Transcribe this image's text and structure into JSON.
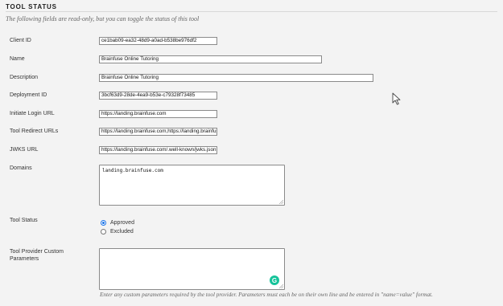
{
  "section": {
    "title": "TOOL STATUS",
    "note": "The following fields are read-only, but you can toggle the status of this tool"
  },
  "fields": {
    "client_id": {
      "label": "Client ID",
      "value": "ce1bab09-ea32-48d9-a0ad-b538be976df2"
    },
    "name": {
      "label": "Name",
      "value": "Brainfuse Online Tutoring"
    },
    "description": {
      "label": "Description",
      "value": "Brainfuse Online Tutoring"
    },
    "deployment_id": {
      "label": "Deployment ID",
      "value": "3bcf63d9-28de-4ea9-b53e-c79328f73485"
    },
    "initiate_login_url": {
      "label": "Initiate Login URL",
      "value": "https://landing.brainfuse.com"
    },
    "tool_redirect_urls": {
      "label": "Tool Redirect URLs",
      "value": "https://landing.brainfuse.com,https://landing.brainfuse.com/"
    },
    "jwks_url": {
      "label": "JWKS URL",
      "value": "https://landing.brainfuse.com/.well-known/jwks.json"
    },
    "domains": {
      "label": "Domains",
      "value": "landing.brainfuse.com"
    }
  },
  "tool_status": {
    "label": "Tool Status",
    "options": [
      "Approved",
      "Excluded"
    ],
    "selected": "Approved"
  },
  "custom_params": {
    "label": "Tool Provider Custom Parameters",
    "value": "",
    "hint": "Enter any custom parameters required by the tool provider. Parameters must each be on their own line and be entered in \"name=value\" format.",
    "grammarly_glyph": "G"
  },
  "icons": {
    "cursor": "mouse-pointer-icon",
    "grammarly": "grammarly-icon"
  },
  "colors": {
    "radio_selected": "#1a73e8",
    "grammarly": "#15c39a"
  }
}
